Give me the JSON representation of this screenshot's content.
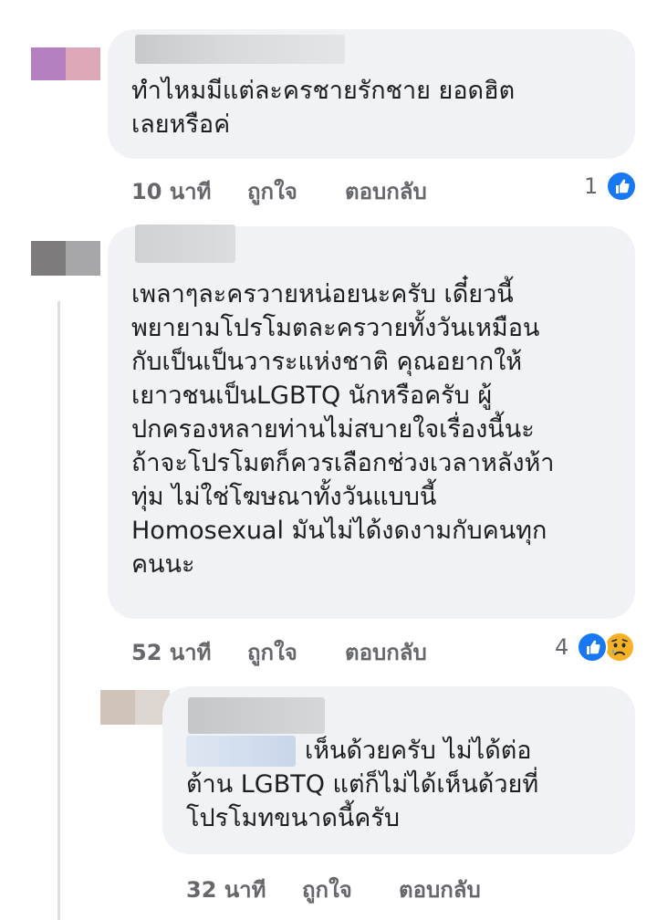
{
  "comments": [
    {
      "text": "ทำไหมมีแต่ละครชายรักชาย ยอดฮิต\nเลยหรือค่",
      "time": "10 นาที",
      "like_label": "ถูกใจ",
      "reply_label": "ตอบกลับ",
      "reaction_count": "1",
      "reactions": [
        "like-icon"
      ]
    },
    {
      "text": "เพลาๆละครวายหน่อยนะครับ เดี๋ยวนี้\nพยายามโปรโมตละครวายทั้งวันเหมือน\nกับเป็นเป็นวาระแห่งชาติ คุณอยากให้\nเยาวชนเป็นLGBTQ นักหรือครับ ผู้\nปกครองหลายท่านไม่สบายใจเรื่องนี้นะ\nถ้าจะโปรโมตก็ควรเลือกช่วงเวลาหลังห้า\nทุ่ม ไม่ใช่โฆษณาทั้งวันแบบนี้\nHomosexual มันไม่ได้งดงามกับคนทุก\nคนนะ",
      "time": "52 นาที",
      "like_label": "ถูกใจ",
      "reply_label": "ตอบกลับ",
      "reaction_count": "4",
      "reactions": [
        "like-icon",
        "sad-icon"
      ]
    }
  ],
  "reply": {
    "text_first": "เห็นด้วยครับ ไม่ได้ต่อ",
    "text_rest": "ต้าน LGBTQ แต่ก็ไม่ได้เห็นด้วยที่\nโปรโมทขนาดนี้ครับ",
    "time": "32 นาที",
    "like_label": "ถูกใจ",
    "reply_label": "ตอบกลับ"
  }
}
